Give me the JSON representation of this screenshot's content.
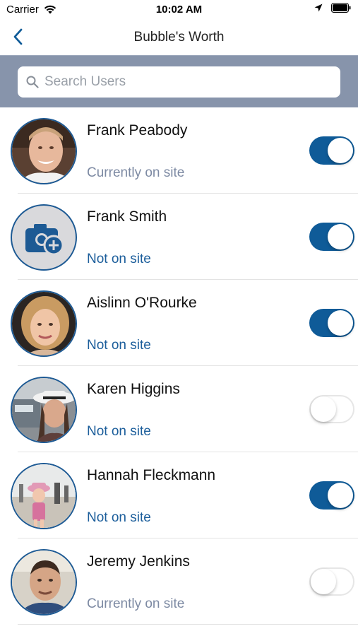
{
  "status_bar": {
    "carrier": "Carrier",
    "time": "10:02 AM",
    "icons": [
      "wifi-icon",
      "location-arrow-icon",
      "battery-icon"
    ]
  },
  "nav": {
    "back_icon": "chevron-left-icon",
    "title": "Bubble's Worth"
  },
  "search": {
    "placeholder": "Search Users",
    "value": ""
  },
  "colors": {
    "accent": "#0f5b98",
    "search_band": "#8794ab",
    "status_on_site": "#7d8aa3",
    "status_not_on_site": "#1c5e9b"
  },
  "users": [
    {
      "name": "Frank Peabody",
      "status": "Currently on site",
      "status_type": "on",
      "toggle": true,
      "avatar": "photo"
    },
    {
      "name": "Frank Smith",
      "status": "Not on site",
      "status_type": "off",
      "toggle": true,
      "avatar": "add-photo-icon"
    },
    {
      "name": "Aislinn O'Rourke",
      "status": "Not on site",
      "status_type": "off",
      "toggle": true,
      "avatar": "photo"
    },
    {
      "name": "Karen Higgins",
      "status": "Not on site",
      "status_type": "off",
      "toggle": false,
      "avatar": "photo"
    },
    {
      "name": "Hannah Fleckmann",
      "status": "Not on site",
      "status_type": "off",
      "toggle": true,
      "avatar": "photo"
    },
    {
      "name": "Jeremy Jenkins",
      "status": "Currently on site",
      "status_type": "on",
      "toggle": false,
      "avatar": "photo"
    }
  ]
}
